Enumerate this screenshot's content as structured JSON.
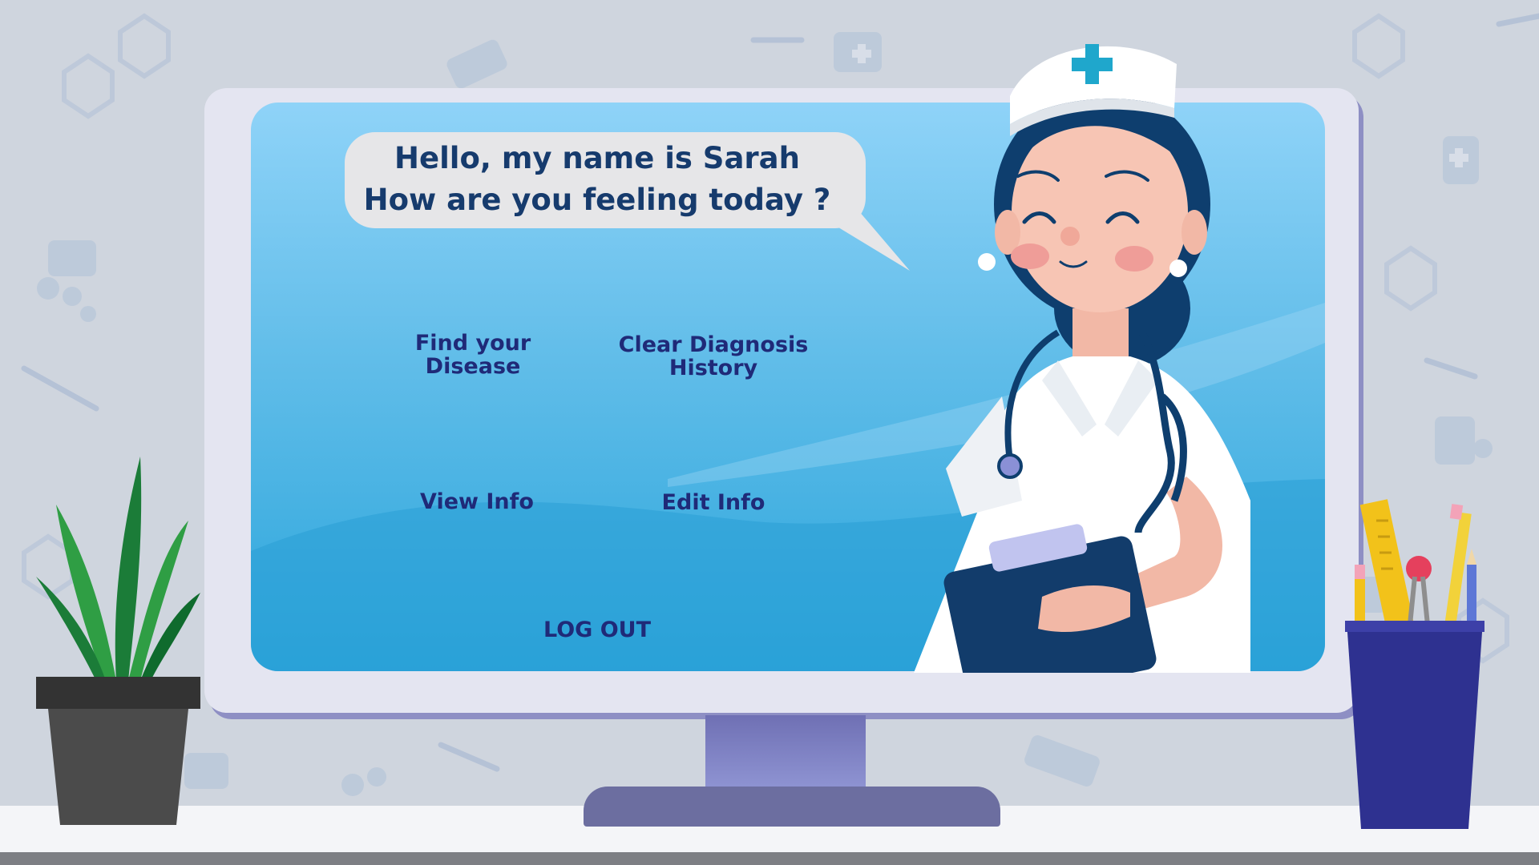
{
  "speech_bubble": {
    "line1": "Hello, my name is Sarah",
    "line2": "How are you feeling today ?"
  },
  "menu": {
    "find_disease": [
      "Find your",
      "Disease"
    ],
    "clear_history": [
      "Clear Diagnosis",
      "History"
    ],
    "view_info": "View Info",
    "edit_info": "Edit Info",
    "logout": "LOG OUT"
  },
  "icons": [
    "nurse-illustration",
    "plant-icon",
    "pencil-cup-icon",
    "medical-cross-icon"
  ],
  "colors": {
    "button_text": "#1f2a78",
    "bubble_text": "#163b6d",
    "screen_top": "#8fd3f8",
    "screen_bottom": "#2aa5db",
    "monitor_frame": "#e4e5f1"
  }
}
